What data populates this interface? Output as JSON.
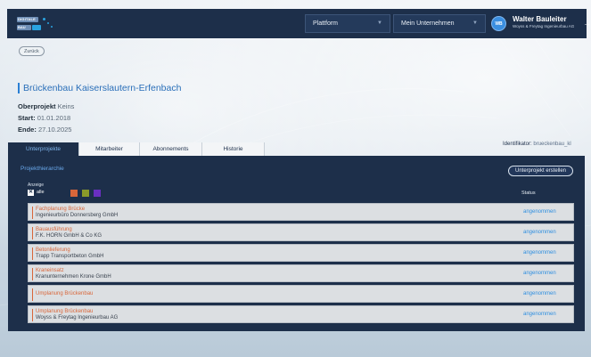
{
  "header": {
    "logo": {
      "line1": "DIGITALE",
      "line2": "BAU"
    },
    "platform_select": "Plattform",
    "company_select": "Mein Unternehmen",
    "user": {
      "initials": "WB",
      "name": "Walter Bauleiter",
      "company": "Woyss & Freytag Ingenieurbau AG"
    }
  },
  "back_label": "Zurück",
  "project": {
    "title": "Brückenbau Kaiserslautern-Erfenbach",
    "oberprojekt_label": "Oberprojekt",
    "oberprojekt_value": "Keins",
    "start_label": "Start:",
    "start_value": "01.01.2018",
    "end_label": "Ende:",
    "end_value": "27.10.2025",
    "identifier_label": "Identifikator:",
    "identifier_value": "brueckenbau_kl"
  },
  "tabs": [
    {
      "label": "Unterprojekte",
      "active": true
    },
    {
      "label": "Mitarbeiter",
      "active": false
    },
    {
      "label": "Abonnements",
      "active": false
    },
    {
      "label": "Historie",
      "active": false
    }
  ],
  "hierarchy": {
    "title": "Projekthierarchie",
    "create_button": "Unterprojekt erstellen",
    "anzeige_label": "Anzeige",
    "alle_label": "alle",
    "filter_colors": [
      "#d9663a",
      "#8a9a2a",
      "#6a2fc0"
    ],
    "status_header": "Status",
    "rows": [
      {
        "name": "Fachplanung Brücke",
        "company": "Ingenieurbüro Donnersberg GmbH",
        "status": "angenommen"
      },
      {
        "name": "Bauausführung",
        "company": "F.K. HORN GmbH & Co KG",
        "status": "angenommen"
      },
      {
        "name": "Betonlieferung",
        "company": "Trapp Transportbeton GmbH",
        "status": "angenommen"
      },
      {
        "name": "Kraneinsatz",
        "company": "Kranunternehmen Krone GmbH",
        "status": "angenommen"
      },
      {
        "name": "Umplanung Brückenbau",
        "company": "",
        "status": "angenommen"
      },
      {
        "name": "Umplanung Brückenbau",
        "company": "Woyss & Freytag Ingenieurbau AG",
        "status": "angenommen"
      }
    ]
  },
  "colors": {
    "navy": "#1d2f4a",
    "accent_blue": "#2a7fd4",
    "row_accent": "#d9663a",
    "status_blue": "#2f8fe0"
  }
}
